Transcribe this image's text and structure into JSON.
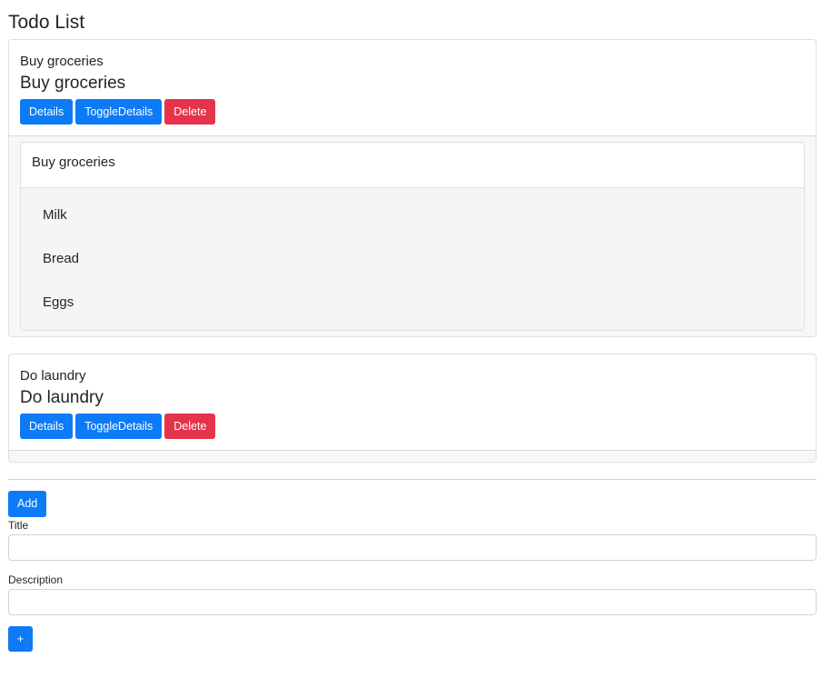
{
  "page": {
    "title": "Todo List"
  },
  "todos": [
    {
      "subtitle": "Buy groceries",
      "title": "Buy groceries",
      "buttons": {
        "details": "Details",
        "toggle": "ToggleDetails",
        "delete": "Delete"
      },
      "details": {
        "header": "Buy groceries",
        "items": [
          "Milk",
          "Bread",
          "Eggs"
        ]
      }
    },
    {
      "subtitle": "Do laundry",
      "title": "Do laundry",
      "buttons": {
        "details": "Details",
        "toggle": "ToggleDetails",
        "delete": "Delete"
      }
    }
  ],
  "form": {
    "add_label": "Add",
    "title_label": "Title",
    "title_value": "",
    "description_label": "Description",
    "description_value": "",
    "submit_label": "+"
  },
  "colors": {
    "primary": "#0d7bf7",
    "danger": "#e5334b"
  }
}
